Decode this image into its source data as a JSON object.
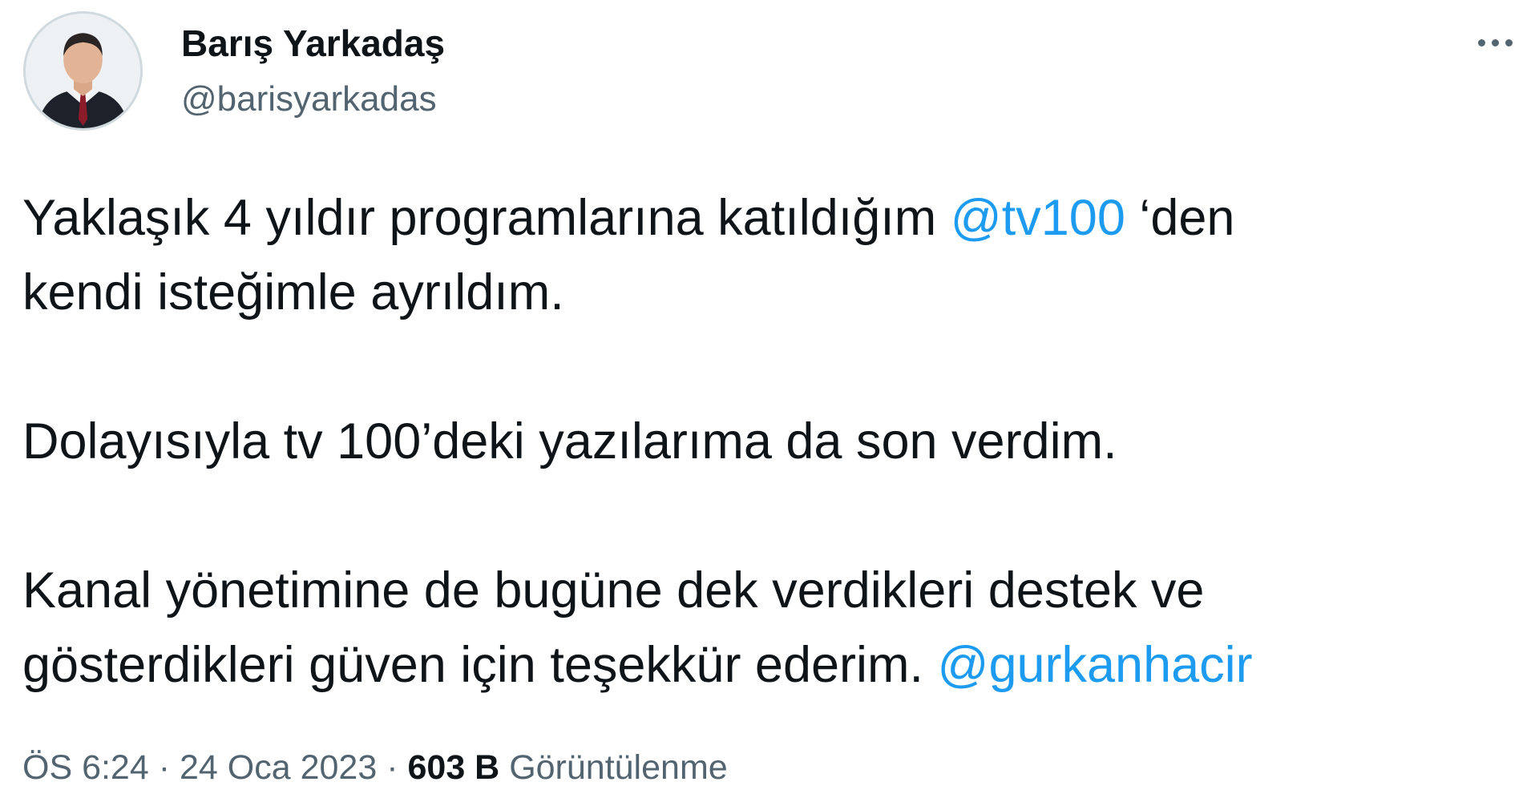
{
  "author": {
    "display_name": "Barış Yarkadaş",
    "handle": "@barisyarkadas"
  },
  "tweet": {
    "line1_before": "Yaklaşık 4 yıldır programlarına katıldığım ",
    "line1_mention": "@tv100",
    "line1_after": " ‘den",
    "line2": "kendi isteğimle ayrıldım.",
    "line3": "Dolayısıyla tv 100’deki yazılarıma da son verdim.",
    "line4": "Kanal yönetimine de bugüne dek verdikleri destek ve",
    "line5_before": "gösterdikleri güven için teşekkür ederim. ",
    "line5_mention": "@gurkanhacir"
  },
  "meta": {
    "time": "ÖS 6:24",
    "separator": "·",
    "date": "24 Oca 2023",
    "views_count": "603 B",
    "views_label": "Görüntülenme"
  },
  "icons": {
    "more": "more-horizontal-icon"
  },
  "colors": {
    "text": "#0f1419",
    "secondary": "#536471",
    "link": "#1d9bf0"
  }
}
